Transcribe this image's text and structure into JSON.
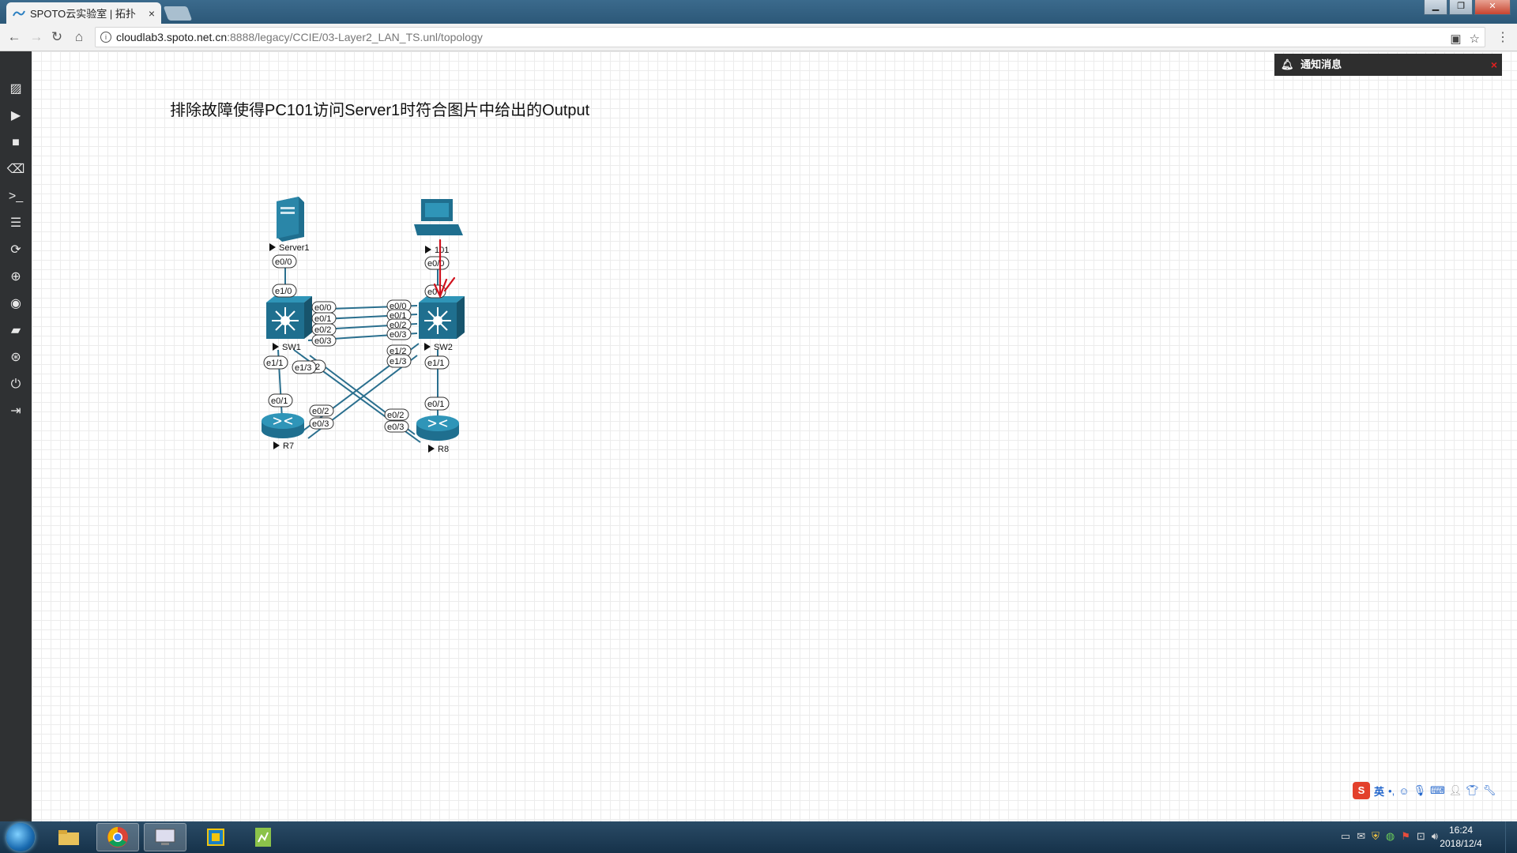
{
  "browser": {
    "tab_title": "SPOTO云实验室 | 拓扑",
    "tab_close": "×",
    "url_host": "cloudlab3.spoto.net.cn",
    "url_rest": ":8888/legacy/CCIE/03-Layer2_LAN_TS.unl/topology",
    "window_buttons": [
      "▁",
      "❐",
      "✕"
    ]
  },
  "sidebar": {
    "icons": [
      "image-icon",
      "play-icon",
      "stop-icon",
      "eraser-icon",
      "console-icon",
      "list-icon",
      "refresh-icon",
      "zoom-icon",
      "eye-icon",
      "camera-icon",
      "plus-circle-icon",
      "power-icon",
      "logout-icon"
    ]
  },
  "canvas": {
    "task_text": "排除故障使得PC101访问Server1时符合图片中给出的Output"
  },
  "notification": {
    "title": "通知消息",
    "close": "×"
  },
  "topology": {
    "nodes": {
      "server1": "Server1",
      "pc101": "101",
      "sw1": "SW1",
      "sw2": "SW2",
      "r7": "R7",
      "r8": "R8"
    },
    "ports": {
      "server1_e00": "e0/0",
      "pc_e00": "e0/0",
      "sw2_top": "e0",
      "sw1_e10": "e1/0",
      "sw1_e00": "e0/0",
      "sw1_e01": "e0/1",
      "sw1_e02": "e0/2",
      "sw1_e03": "e0/3",
      "sw2_e00": "e0/0",
      "sw2_e01": "e0/1",
      "sw2_e02": "e0/2",
      "sw2_e03": "e0/3",
      "sw1_e11": "e1/1",
      "sw1_e13": "e1/3",
      "sw1_e12_partial": "2",
      "sw2_e12": "e1/2",
      "sw2_e13": "e1/3",
      "sw2_e11": "e1/1",
      "r7_e01": "e0/1",
      "r7_e02": "e0/2",
      "r7_e03": "e0/3",
      "r8_e02": "e0/2",
      "r8_e03": "e0/3",
      "r8_e01": "e0/1"
    }
  },
  "ime": {
    "logo": "S",
    "lang": "英",
    "icons": [
      "punct-icon",
      "emoji-icon",
      "mic-icon",
      "keyboard-icon",
      "user-icon",
      "shirt-icon",
      "wrench-icon"
    ]
  },
  "taskbar": {
    "apps": [
      "explorer-icon",
      "chrome-icon",
      "remote-desktop-icon",
      "virtualbox-icon",
      "notepad-icon"
    ],
    "time": "16:24",
    "date": "2018/12/4"
  }
}
